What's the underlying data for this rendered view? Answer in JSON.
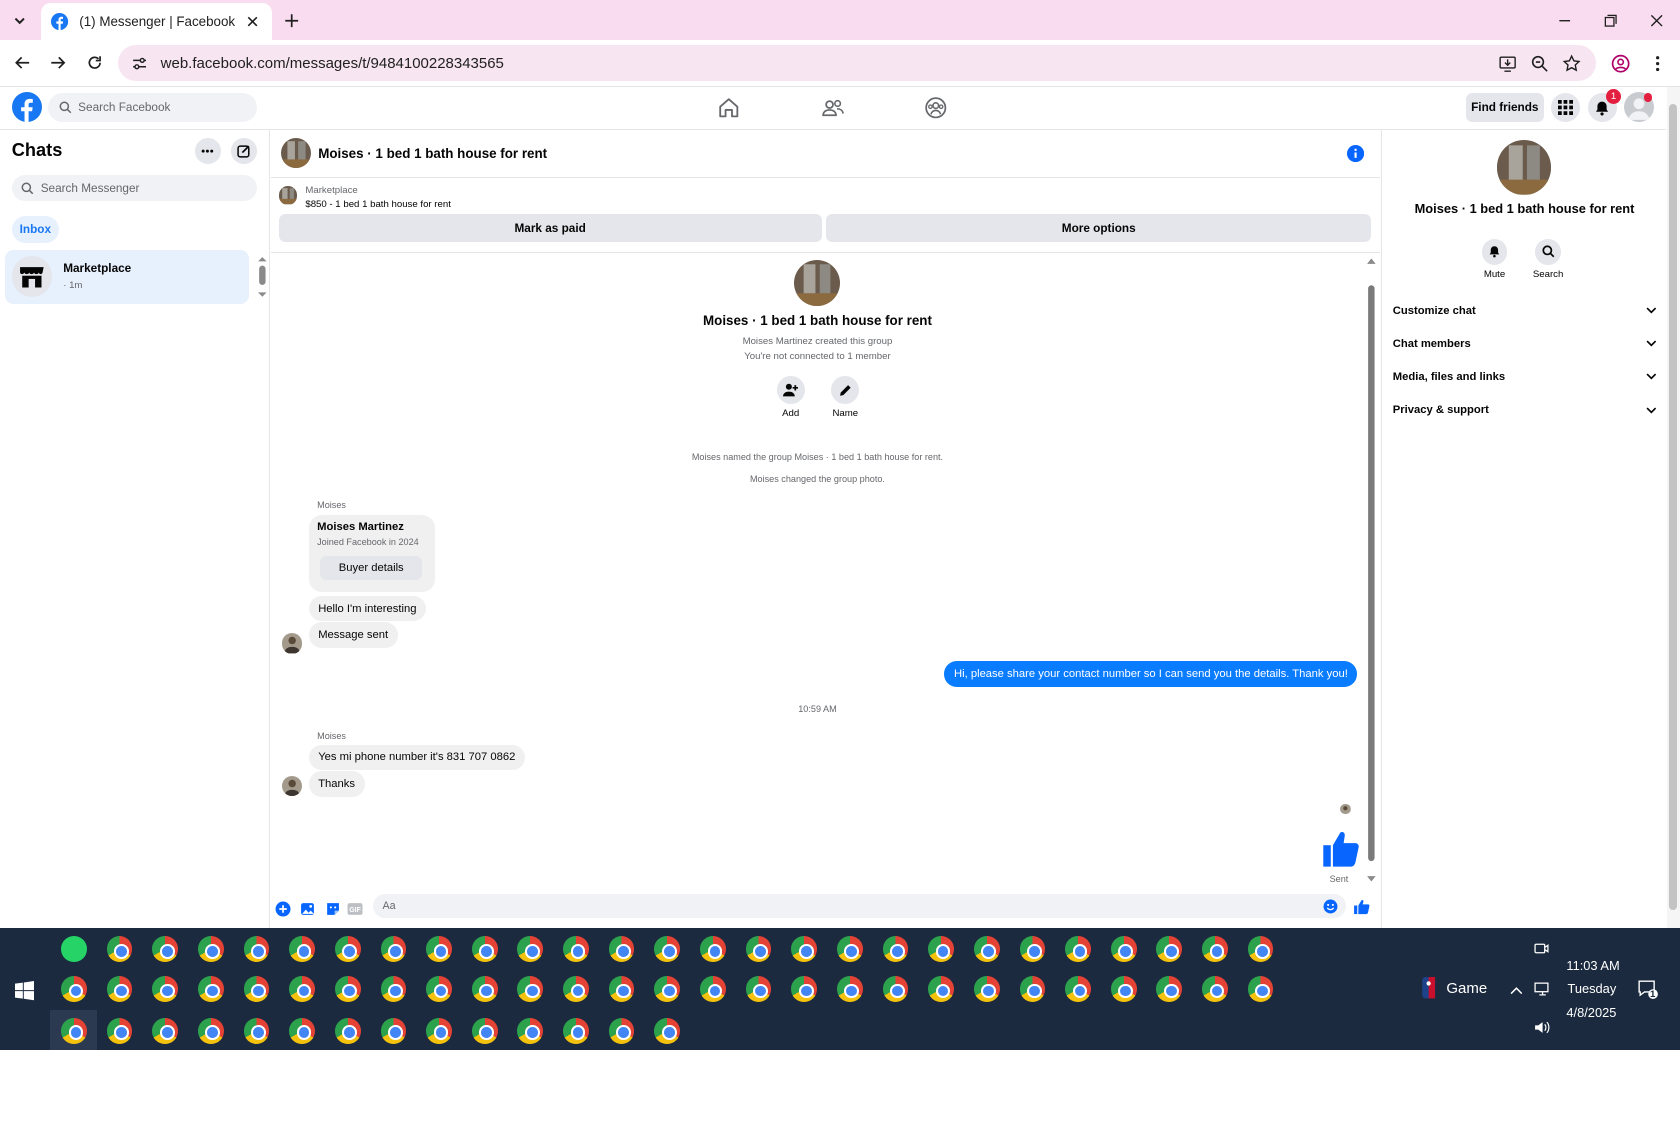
{
  "browser": {
    "tab_title": "(1) Messenger | Facebook",
    "url": "web.facebook.com/messages/t/9484100228343565"
  },
  "facebook": {
    "search_placeholder": "Search Facebook",
    "find_friends_label": "Find friends",
    "notification_count": "1",
    "brand_color": "#1877f2"
  },
  "sidebar": {
    "title": "Chats",
    "search_placeholder": "Search Messenger",
    "filter_label": "Inbox",
    "chats": [
      {
        "name": "Marketplace",
        "time": "· 1m"
      }
    ]
  },
  "conversation": {
    "title": "Moises · 1 bed 1 bath house for rent",
    "marketplace": {
      "label": "Marketplace",
      "listing": "$850 - 1 bed 1 bath house for rent",
      "mark_paid_label": "Mark as paid",
      "more_options_label": "More options"
    },
    "group": {
      "title": "Moises · 1 bed 1 bath house for rent",
      "created_by": "Moises Martinez created this group",
      "not_connected": "You're not connected to 1 member",
      "add_label": "Add",
      "name_label": "Name"
    },
    "system_messages": [
      "Moises named the group Moises · 1 bed 1 bath house for rent.",
      "Moises changed the group photo."
    ],
    "sender_name": "Moises",
    "profile_card": {
      "name": "Moises Martinez",
      "joined": "Joined Facebook in 2024",
      "button_label": "Buyer details"
    },
    "messages_block1": [
      "Hello I'm interesting",
      "Message sent"
    ],
    "my_message": "Hi, please share your contact number so I can send you the details. Thank you!",
    "timestamp": "10:59 AM",
    "messages_block2": [
      "Yes mi phone number it's 831 707 0862",
      "Thanks"
    ],
    "sent_status": "Sent",
    "composer_placeholder": "Aa",
    "my_bubble_color": "#0a7cff"
  },
  "details": {
    "title": "Moises · 1 bed 1 bath house for rent",
    "mute_label": "Mute",
    "search_label": "Search",
    "sections": [
      "Customize chat",
      "Chat members",
      "Media, files and links",
      "Privacy & support"
    ]
  },
  "taskbar": {
    "game_label": "Game",
    "time": "11:03 AM",
    "day": "Tuesday",
    "date": "4/8/2025",
    "notification_count": "1"
  }
}
